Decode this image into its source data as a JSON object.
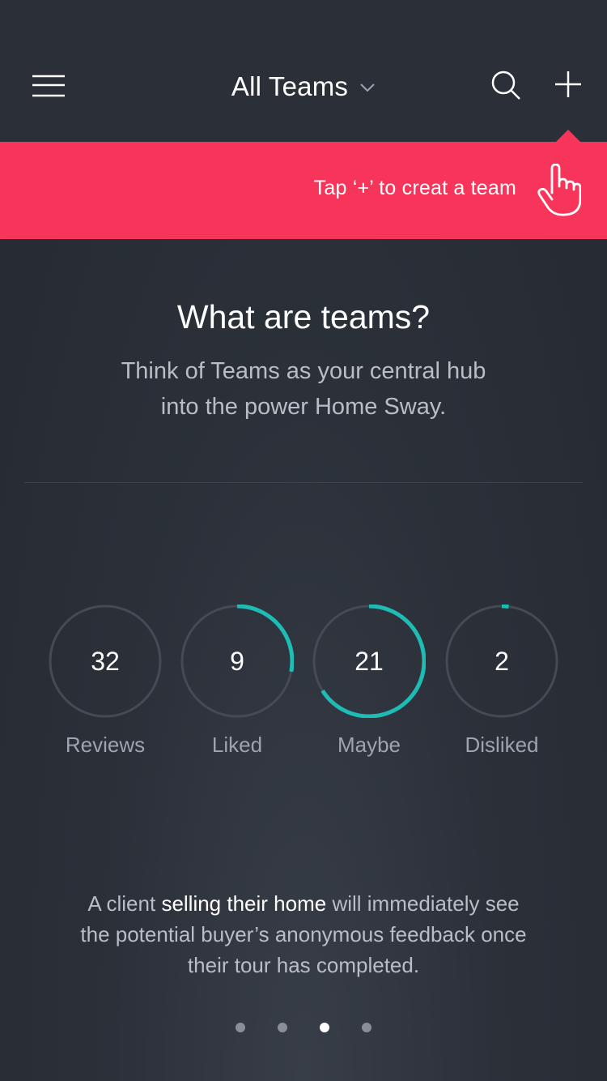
{
  "header": {
    "title": "All Teams",
    "icons": [
      "menu-icon",
      "chevron-down-icon",
      "search-icon",
      "plus-icon"
    ]
  },
  "banner": {
    "text": "Tap ‘+’ to creat a team",
    "icon": "pointing-hand-icon",
    "color": "#f7355a"
  },
  "intro": {
    "heading": "What are teams?",
    "line1": "Think of Teams as your central hub",
    "line2": "into the power Home Sway."
  },
  "stats": [
    {
      "value": "32",
      "label": "Reviews",
      "progress": 0
    },
    {
      "value": "9",
      "label": "Liked",
      "progress": 0.28
    },
    {
      "value": "21",
      "label": "Maybe",
      "progress": 0.66
    },
    {
      "value": "2",
      "label": "Disliked",
      "progress": 0.02
    }
  ],
  "description": {
    "before": "A client ",
    "highlight": "selling their home",
    "after": " will immediately see the potential buyer’s anonymous feedback once their tour has completed."
  },
  "pagination": {
    "pages": 4,
    "active_index": 2
  },
  "colors": {
    "accent": "#f7355a",
    "ring_progress": "#1ebcb4",
    "ring_track": "#454a53",
    "background": "#2b3039"
  }
}
